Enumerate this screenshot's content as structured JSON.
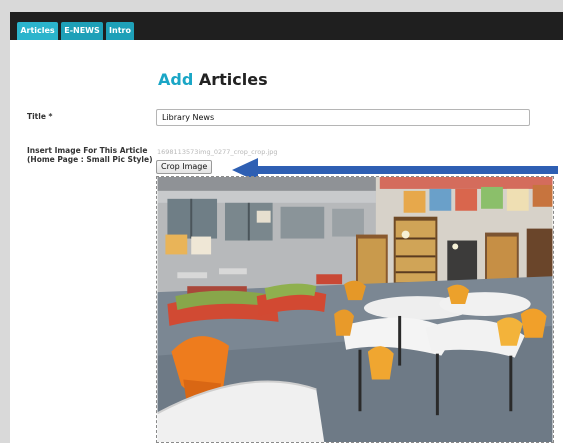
{
  "tabs": [
    {
      "label": "Articles",
      "active": true
    },
    {
      "label": "E-NEWS",
      "active": false
    },
    {
      "label": "Intro",
      "active": false
    }
  ],
  "heading": {
    "accent": "Add",
    "rest": " Articles"
  },
  "form": {
    "title_label": "Title *",
    "title_value": "Library News",
    "image_label_line1": "Insert Image For This Article",
    "image_label_line2": "(Home Page : Small Pic Style)",
    "image_filename": "1698113573img_0277_crop_crop.jpg",
    "crop_button_label": "Crop Image"
  },
  "colors": {
    "accent": "#1aa6c6",
    "tab_bg": "#1ea0b8",
    "tab_bar": "#1f1f1f",
    "arrow": "#2e5fb3"
  },
  "icons": {
    "annotation": "arrow-left-icon"
  }
}
